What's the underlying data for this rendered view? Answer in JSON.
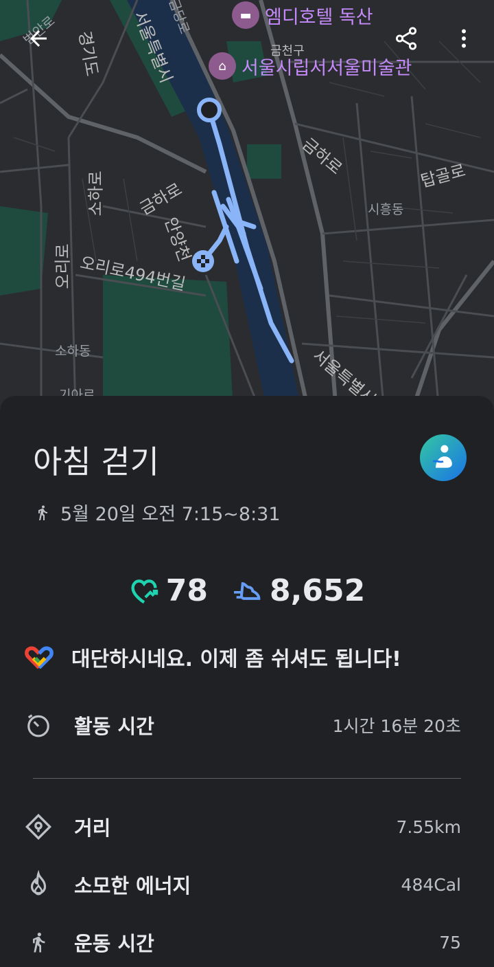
{
  "map": {
    "poi_hotel": "엠디호텔 독산",
    "district": "금천구",
    "poi_museum": "서울시립서서울미술관",
    "labels": [
      "금하로",
      "탑골로",
      "시흥동",
      "금하로",
      "소하로",
      "오리로494번길",
      "오리로",
      "소하동",
      "경기도",
      "서울특별시",
      "서울특별시",
      "안양천",
      "기아로",
      "범안로",
      "금당로"
    ]
  },
  "header": {
    "back": "arrow-left-icon",
    "share": "share-icon",
    "more": "more-vert-icon"
  },
  "activity": {
    "title": "아침 걷기",
    "datetime": "5월 20일 오전 7:15~8:31",
    "heart_points": "78",
    "steps": "8,652",
    "message": "대단하시네요. 이제 좀 쉬셔도 됩니다!",
    "rows": [
      {
        "label": "활동 시간",
        "value": "1시간 16분 20초"
      },
      {
        "label": "거리",
        "value": "7.55km"
      },
      {
        "label": "소모한 에너지",
        "value": "484Cal"
      },
      {
        "label": "운동 시간",
        "value": "75"
      }
    ]
  },
  "colors": {
    "route": "#8ab4f8",
    "heart": "#1fd3b0",
    "steps": "#669df6"
  }
}
